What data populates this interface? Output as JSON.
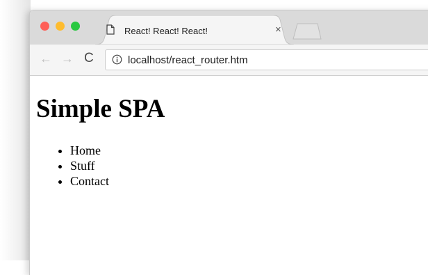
{
  "browser": {
    "tab": {
      "title": "React! React! React!",
      "close_glyph": "×",
      "icon": "document-icon"
    },
    "toolbar": {
      "back_glyph": "←",
      "forward_glyph": "→",
      "reload_glyph": "C",
      "url": "localhost/react_router.htm",
      "info_icon": "info-icon"
    },
    "traffic_lights": {
      "close_color": "#fe5f57",
      "minimize_color": "#febc2e",
      "maximize_color": "#28c840"
    }
  },
  "page": {
    "title": "Simple SPA",
    "nav_items": [
      {
        "label": "Home"
      },
      {
        "label": "Stuff"
      },
      {
        "label": "Contact"
      }
    ]
  }
}
